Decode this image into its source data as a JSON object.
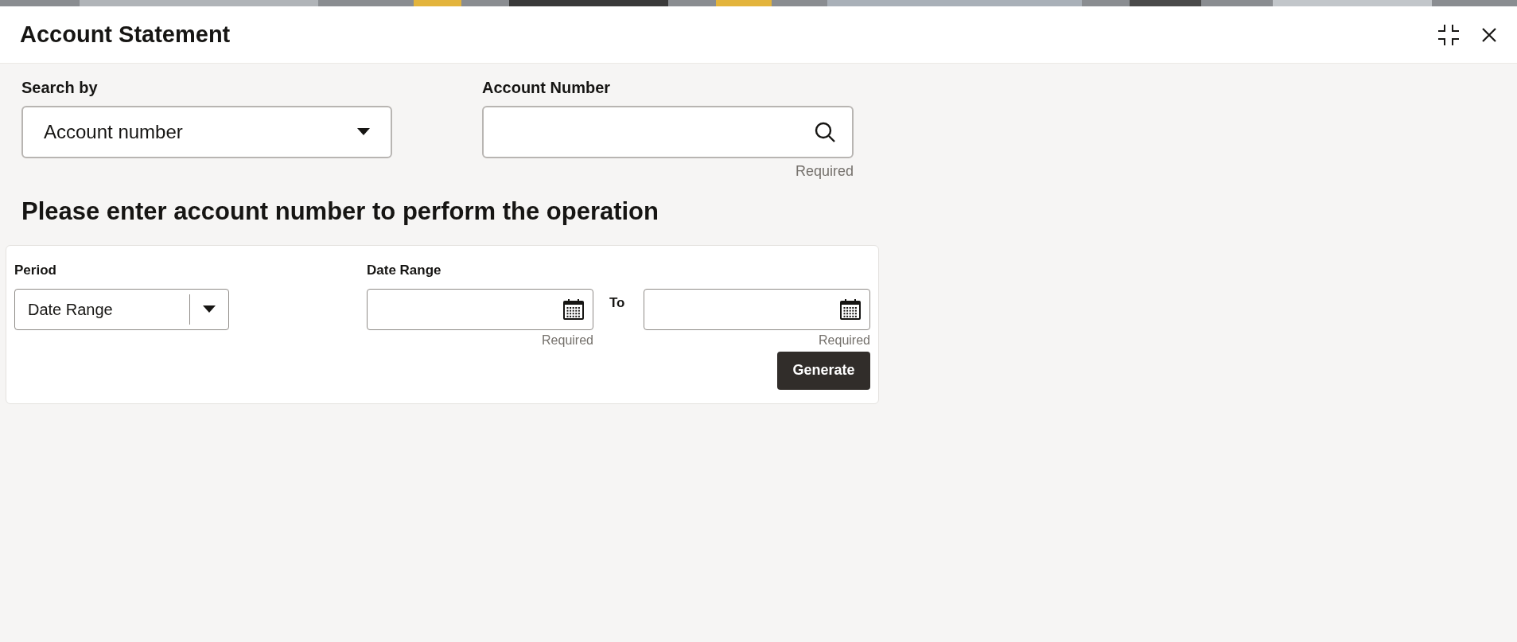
{
  "window": {
    "title": "Account Statement"
  },
  "search_by": {
    "label": "Search by",
    "value": "Account number"
  },
  "account_number": {
    "label": "Account Number",
    "hint": "Required"
  },
  "message": "Please enter account number to perform the operation",
  "period": {
    "label": "Period",
    "value": "Date Range"
  },
  "date_range": {
    "label": "Date Range",
    "from_hint": "Required",
    "to_label": "To",
    "to_hint": "Required"
  },
  "buttons": [
    "Generate"
  ]
}
